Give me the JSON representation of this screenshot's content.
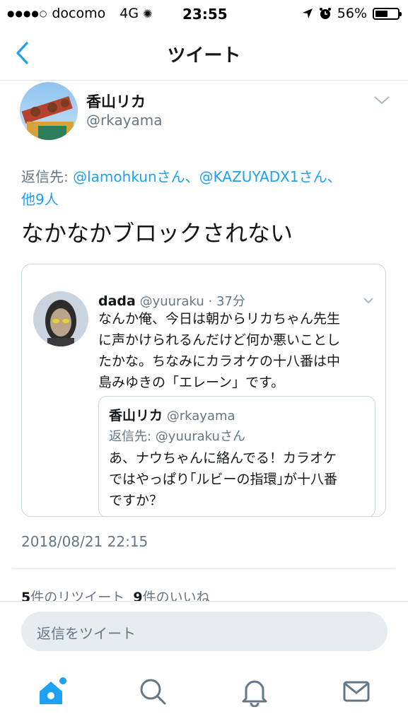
{
  "status_bar": {
    "carrier": "docomo",
    "network": "4G",
    "time": "23:55",
    "battery": "56%",
    "battery_level": 0.56
  },
  "nav": {
    "title": "ツイート",
    "back_icon": "chevron-left-icon"
  },
  "tweet": {
    "display_name": "香山リカ",
    "handle": "@rkayama",
    "reply_prefix": "返信先: ",
    "reply_mention_1": "@lamohkun",
    "reply_sep_1": "さん、",
    "reply_mention_2": "@KAZUYADX1",
    "reply_sep_2": "さん、",
    "reply_others": "他9人",
    "text": "なかなかブロックされない",
    "timestamp": "2018/08/21 22:15",
    "retweet_count": "5",
    "retweet_label": "件のリツイート",
    "like_count": "9",
    "like_label": "件のいいね"
  },
  "quoted_tweet": {
    "display_name": "dada",
    "handle": "@yuuraku",
    "time": "· 37分",
    "text_lines": [
      "なんか俺、今日は朝からリカちゃん先生",
      "に声かけられるんだけど何か悪いことし",
      "たかな。ちなみにカラオケの十八番は中",
      "島みゆきの「エレーン」です。"
    ],
    "nested": {
      "display_name": "香山リカ",
      "handle": "@rkayama",
      "reply_to": "返信先: @yuurakuさん",
      "text_lines": [
        "あ、ナウちゃんに絡んでる！カラオケ",
        "ではやっぱり｢ルビーの指環｣が十八番",
        "ですか？"
      ]
    }
  },
  "composer": {
    "placeholder": "返信をツイート"
  },
  "tabbar": {
    "items": [
      "home-icon",
      "search-icon",
      "notifications-bell-icon",
      "messages-envelope-icon"
    ]
  },
  "colors": {
    "accent": "#1da1f2",
    "secondary_text": "#657786",
    "border": "#e1e8ed"
  }
}
